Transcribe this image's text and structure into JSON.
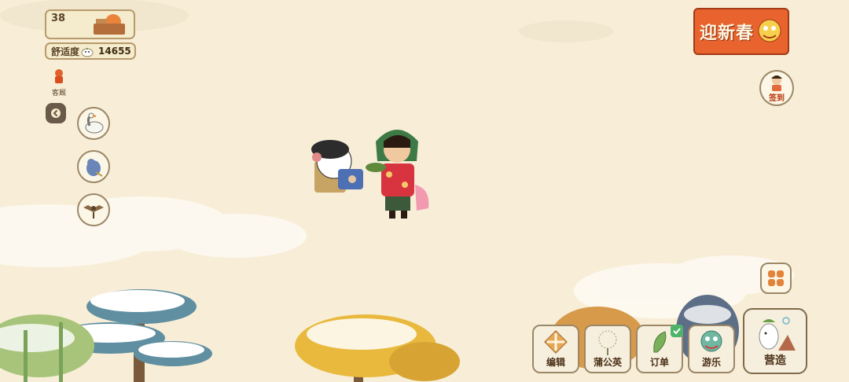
{
  "hud": {
    "level": "38",
    "comfort_label": "舒适度",
    "comfort_value": "14655",
    "guest_caption": "客厩"
  },
  "event": {
    "title": "迎新春"
  },
  "signin": {
    "label": "签到"
  },
  "toolbar": {
    "edit": "编辑",
    "dandelion": "蒲公英",
    "orders": "订单",
    "fun": "游乐",
    "build": "营造"
  },
  "icons": {
    "collapse": "chevron-left-icon",
    "visitors": [
      "goose-icon",
      "blue-bird-icon",
      "eagle-icon"
    ],
    "menu": "grid-icon"
  },
  "colors": {
    "background": "#f8eed8",
    "event_red": "#e8632e",
    "border_brown": "#9c8767",
    "check_green": "#4fb36a"
  }
}
